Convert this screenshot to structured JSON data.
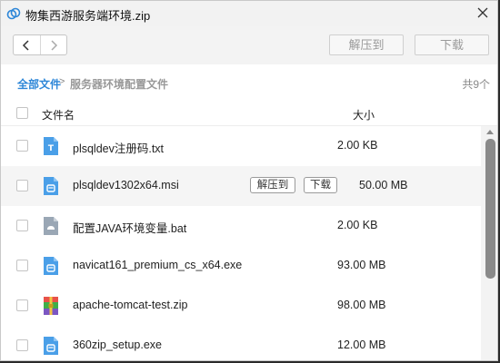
{
  "window": {
    "title": "物集西游服务端环境.zip"
  },
  "toolbar": {
    "extract_label": "解压到",
    "download_label": "下载"
  },
  "breadcrumb": {
    "root": "全部文件",
    "separator": ">",
    "current": "服务器环境配置文件",
    "count": "共9个"
  },
  "list_header": {
    "name": "文件名",
    "size": "大小"
  },
  "row_actions": {
    "extract_label": "解压到",
    "download_label": "下载"
  },
  "files": [
    {
      "name": "plsqldev注册码.txt",
      "size": "2.00 KB",
      "icon": "text-file-icon"
    },
    {
      "name": "plsqldev1302x64.msi",
      "size": "50.00 MB",
      "icon": "installer-file-icon"
    },
    {
      "name": "配置JAVA环境变量.bat",
      "size": "2.00 KB",
      "icon": "batch-file-icon"
    },
    {
      "name": "navicat161_premium_cs_x64.exe",
      "size": "93.00 MB",
      "icon": "exe-file-icon"
    },
    {
      "name": "apache-tomcat-test.zip",
      "size": "98.00 MB",
      "icon": "zip-file-icon"
    },
    {
      "name": "360zip_setup.exe",
      "size": "12.00 MB",
      "icon": "exe-file-icon"
    }
  ],
  "colors": {
    "accent": "#2e87d8",
    "file_blue": "#4a9fe8",
    "scrollbar": "#8a8a8a"
  }
}
